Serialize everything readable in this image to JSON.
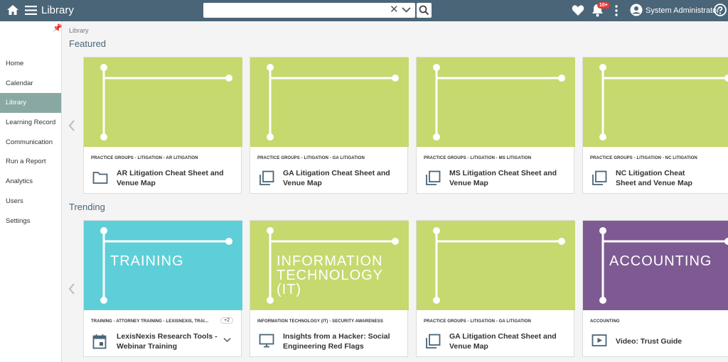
{
  "header": {
    "title": "Library",
    "search_value": "",
    "notification_badge": "10+",
    "user_name": "System Administrator"
  },
  "sidebar": {
    "items": [
      {
        "label": "Home",
        "active": false
      },
      {
        "label": "Calendar",
        "active": false
      },
      {
        "label": "Library",
        "active": true
      },
      {
        "label": "Learning Record",
        "active": false
      },
      {
        "label": "Communication",
        "active": false
      },
      {
        "label": "Run a Report",
        "active": false
      },
      {
        "label": "Analytics",
        "active": false
      },
      {
        "label": "Users",
        "active": false
      },
      {
        "label": "Settings",
        "active": false
      }
    ]
  },
  "breadcrumb": "Library",
  "featured": {
    "heading": "Featured",
    "cards": [
      {
        "meta": "PRACTICE GROUPS - LITIGATION - AR LITIGATION",
        "title": "AR Litigation Cheat Sheet and Venue Map",
        "icon": "folder-icon",
        "color": "#c5d96e",
        "thumb_text": ""
      },
      {
        "meta": "PRACTICE GROUPS - LITIGATION - GA LITIGATION",
        "title": "GA Litigation Cheat Sheet and Venue Map",
        "icon": "copy-icon",
        "color": "#c5d96e",
        "thumb_text": ""
      },
      {
        "meta": "PRACTICE GROUPS - LITIGATION - MS LITIGATION",
        "title": "MS Litigation Cheat Sheet and Venue Map",
        "icon": "copy-icon",
        "color": "#c5d96e",
        "thumb_text": ""
      },
      {
        "meta": "PRACTICE GROUPS - LITIGATION - NC LITIGATION",
        "title": "NC Litigation Cheat Sheet and Venue Map",
        "icon": "copy-icon",
        "color": "#c5d96e",
        "thumb_text": ""
      }
    ]
  },
  "trending": {
    "heading": "Trending",
    "cards": [
      {
        "meta": "TRAINING - ATTORNEY TRAINING - LEXISNEXIS, TRAI...",
        "extra_tags": "+2",
        "title": "LexisNexis Research Tools - Webinar Training",
        "icon": "calendar-icon",
        "color": "#5ecfd9",
        "thumb_text": "TRAINING"
      },
      {
        "meta": "INFORMATION TECHNOLOGY (IT) - SECURITY AWARENESS",
        "title": "Insights from a Hacker: Social Engineering Red Flags",
        "icon": "monitor-icon",
        "color": "#c5d96e",
        "thumb_text": "INFORMATION TECHNOLOGY (IT)"
      },
      {
        "meta": "PRACTICE GROUPS - LITIGATION - GA LITIGATION",
        "title": "GA Litigation Cheat Sheet and Venue Map",
        "icon": "copy-icon",
        "color": "#c5d96e",
        "thumb_text": ""
      },
      {
        "meta": "ACCOUNTING",
        "title": "Video:  Trust Guide",
        "icon": "video-icon",
        "color": "#7e5a92",
        "thumb_text": "ACCOUNTING"
      }
    ]
  }
}
